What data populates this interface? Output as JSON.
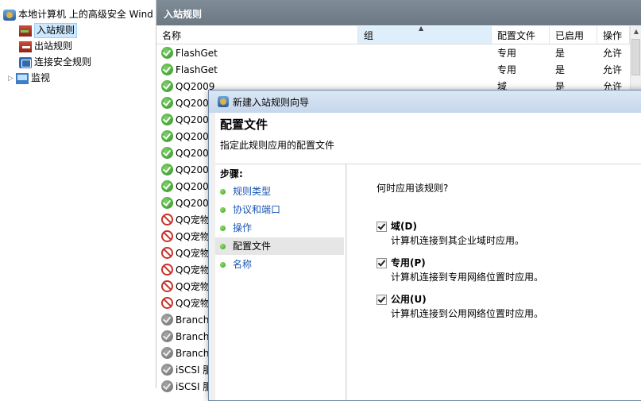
{
  "tree": {
    "root": "本地计算机 上的高级安全 Wind",
    "items": [
      "入站规则",
      "出站规则",
      "连接安全规则",
      "监视"
    ]
  },
  "panel": {
    "title": "入站规则"
  },
  "columns": [
    "名称",
    "组",
    "配置文件",
    "已启用",
    "操作"
  ],
  "rules": [
    {
      "status": "allow",
      "name": "FlashGet",
      "group": "",
      "profile": "专用",
      "enabled": "是",
      "action": "允许"
    },
    {
      "status": "allow",
      "name": "FlashGet",
      "group": "",
      "profile": "专用",
      "enabled": "是",
      "action": "允许"
    },
    {
      "status": "allow",
      "name": "QQ2009",
      "group": "",
      "profile": "域",
      "enabled": "是",
      "action": "允许"
    },
    {
      "status": "allow",
      "name": "QQ200",
      "group": "",
      "profile": "",
      "enabled": "",
      "action": ""
    },
    {
      "status": "allow",
      "name": "QQ200",
      "group": "",
      "profile": "",
      "enabled": "",
      "action": ""
    },
    {
      "status": "allow",
      "name": "QQ200",
      "group": "",
      "profile": "",
      "enabled": "",
      "action": ""
    },
    {
      "status": "allow",
      "name": "QQ200",
      "group": "",
      "profile": "",
      "enabled": "",
      "action": ""
    },
    {
      "status": "allow",
      "name": "QQ200",
      "group": "",
      "profile": "",
      "enabled": "",
      "action": ""
    },
    {
      "status": "allow",
      "name": "QQ200",
      "group": "",
      "profile": "",
      "enabled": "",
      "action": ""
    },
    {
      "status": "allow",
      "name": "QQ200",
      "group": "",
      "profile": "",
      "enabled": "",
      "action": ""
    },
    {
      "status": "block",
      "name": "QQ宠物",
      "group": "",
      "profile": "",
      "enabled": "",
      "action": ""
    },
    {
      "status": "block",
      "name": "QQ宠物",
      "group": "",
      "profile": "",
      "enabled": "",
      "action": ""
    },
    {
      "status": "block",
      "name": "QQ宠物",
      "group": "",
      "profile": "",
      "enabled": "",
      "action": ""
    },
    {
      "status": "block",
      "name": "QQ宠物",
      "group": "",
      "profile": "",
      "enabled": "",
      "action": ""
    },
    {
      "status": "block",
      "name": "QQ宠物",
      "group": "",
      "profile": "",
      "enabled": "",
      "action": ""
    },
    {
      "status": "block",
      "name": "QQ宠物",
      "group": "",
      "profile": "",
      "enabled": "",
      "action": ""
    },
    {
      "status": "off",
      "name": "Branch",
      "group": "",
      "profile": "",
      "enabled": "",
      "action": ""
    },
    {
      "status": "off",
      "name": "Branch",
      "group": "",
      "profile": "",
      "enabled": "",
      "action": ""
    },
    {
      "status": "off",
      "name": "Branch",
      "group": "",
      "profile": "",
      "enabled": "",
      "action": ""
    },
    {
      "status": "off",
      "name": "iSCSI 服",
      "group": "",
      "profile": "",
      "enabled": "",
      "action": ""
    },
    {
      "status": "off",
      "name": "iSCSI 服",
      "group": "",
      "profile": "",
      "enabled": "",
      "action": ""
    }
  ],
  "dialog": {
    "title": "新建入站规则向导",
    "header_title": "配置文件",
    "header_subtitle": "指定此规则应用的配置文件",
    "steps_title": "步骤:",
    "steps": [
      "规则类型",
      "协议和端口",
      "操作",
      "配置文件",
      "名称"
    ],
    "current_step": 3,
    "question": "何时应用该规则?",
    "options": [
      {
        "label": "域(D)",
        "desc": "计算机连接到其企业域时应用。",
        "checked": true
      },
      {
        "label": "专用(P)",
        "desc": "计算机连接到专用网络位置时应用。",
        "checked": true
      },
      {
        "label": "公用(U)",
        "desc": "计算机连接到公用网络位置时应用。",
        "checked": true
      }
    ]
  }
}
